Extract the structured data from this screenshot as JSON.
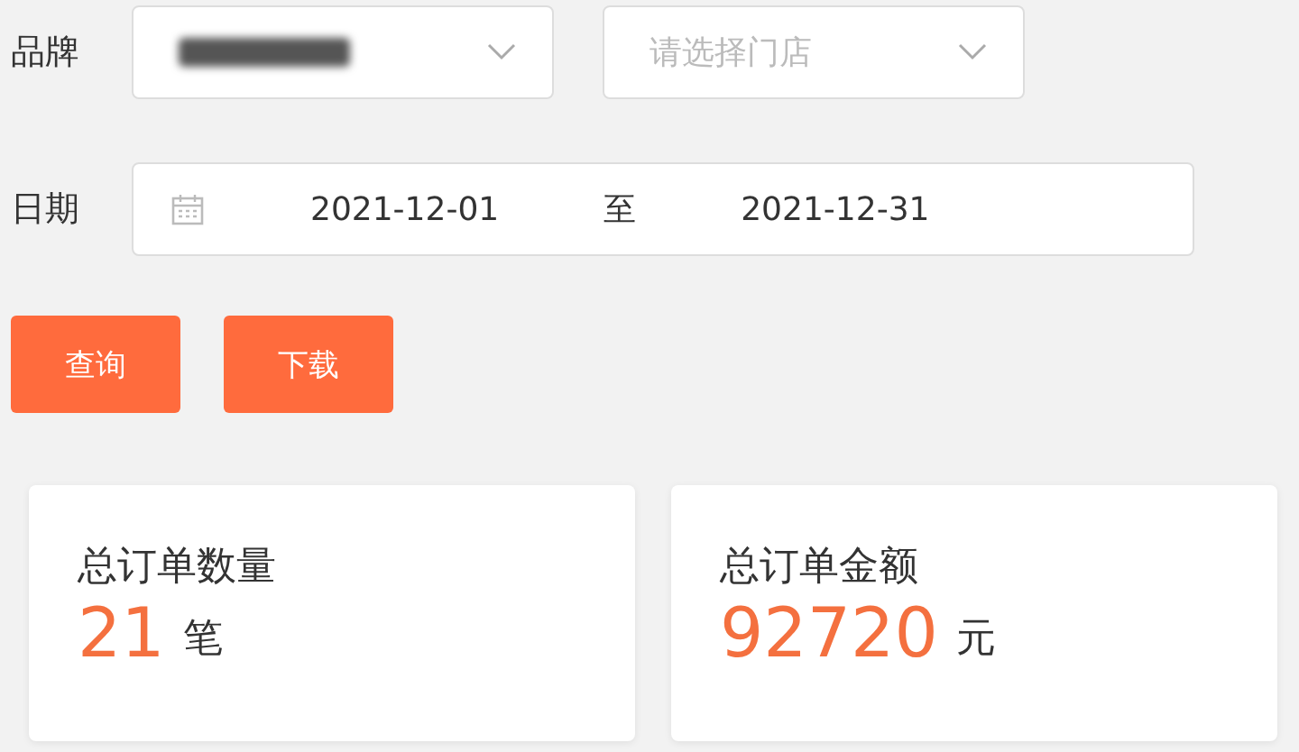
{
  "filters": {
    "brand": {
      "label": "品牌",
      "value_blurred": true
    },
    "store": {
      "placeholder": "请选择门店"
    },
    "date": {
      "label": "日期",
      "start": "2021-12-01",
      "separator": "至",
      "end": "2021-12-31"
    }
  },
  "buttons": [
    "查询",
    "下载"
  ],
  "cards": [
    {
      "title": "总订单数量",
      "value": "21",
      "unit": "笔"
    },
    {
      "title": "总订单金额",
      "value": "92720",
      "unit": "元"
    }
  ]
}
